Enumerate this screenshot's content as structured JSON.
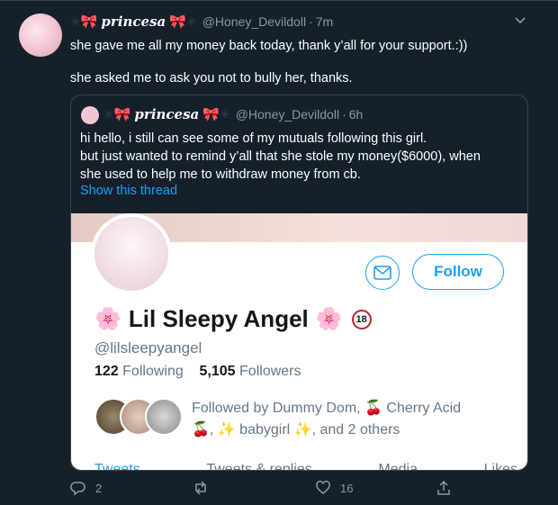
{
  "tweet": {
    "author_name": "princesa",
    "handle": "@Honey_Devildoll",
    "time": "7m",
    "text_line1": "she gave me all my money back today, thank y’all for your support.:))",
    "text_line2": "she asked me to ask you not to bully her, thanks."
  },
  "quote": {
    "author_name": "princesa",
    "handle": "@Honey_Devildoll",
    "time": "6h",
    "text_line1": "hi hello, i still can see some of my mutuals following this girl.",
    "text_line2": "but just wanted to remind y’all that she stole my money($6000), when",
    "text_line3": "she used to help me to withdraw money from cb.",
    "link": "Show this thread"
  },
  "profile_card": {
    "follow_label": "Follow",
    "name": "Lil Sleepy Angel",
    "age_badge": "18",
    "username": "@lilsleepyangel",
    "following_count": "122",
    "following_label": "Following",
    "followers_count": "5,105",
    "followers_label": "Followers",
    "followed_by_line1": "Followed by Dummy Dom, 🍒 Cherry Acid",
    "followed_by_line2": "🍒, ✨ babygirl ✨, and 2 others",
    "tabs": [
      "Tweets",
      "Tweets & replies",
      "Media",
      "Likes"
    ]
  },
  "actions": {
    "reply_count": "2",
    "retweet_count": "",
    "like_count": "16"
  },
  "colors": {
    "background": "#15202b",
    "accent": "#1da1f2",
    "muted": "#8899a6"
  }
}
